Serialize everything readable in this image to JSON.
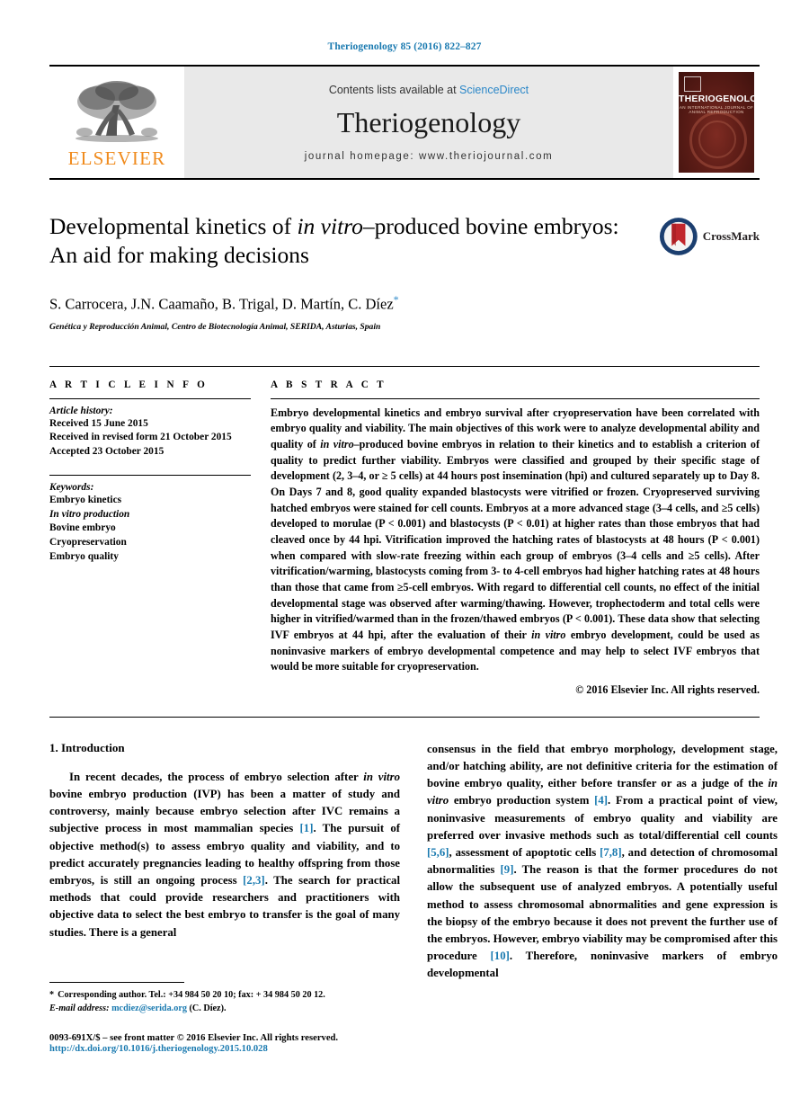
{
  "running_head": "Theriogenology 85 (2016) 822–827",
  "masthead": {
    "publisher_logo_label": "ELSEVIER",
    "contents_prefix": "Contents lists available at ",
    "contents_link": "ScienceDirect",
    "journal_title": "Theriogenology",
    "homepage": "journal homepage: www.theriojournal.com",
    "cover_title": "THERIOGENOLOGY",
    "cover_subtitle": "AN INTERNATIONAL JOURNAL OF ANIMAL REPRODUCTION"
  },
  "article": {
    "title_part1": "Developmental kinetics of ",
    "title_italic": "in vitro",
    "title_part2": "–produced bovine embryos: An aid for making decisions",
    "authors": "S. Carrocera, J.N. Caamaño, B. Trigal, D. Martín, C. Díez",
    "corresponding_marker": "*",
    "affiliation": "Genética y Reproducción Animal, Centro de Biotecnología Animal, SERIDA, Asturias, Spain",
    "crossmark_label": "CrossMark"
  },
  "article_info": {
    "heading": "A R T I C L E   I N F O",
    "history_label": "Article history:",
    "history": [
      "Received 15 June 2015",
      "Received in revised form 21 October 2015",
      "Accepted 23 October 2015"
    ],
    "keywords_label": "Keywords:",
    "keywords": [
      "Embryo kinetics",
      "In vitro production",
      "Bovine embryo",
      "Cryopreservation",
      "Embryo quality"
    ]
  },
  "abstract": {
    "heading": "A B S T R A C T",
    "text_a": "Embryo developmental kinetics and embryo survival after cryopreservation have been correlated with embryo quality and viability. The main objectives of this work were to analyze developmental ability and quality of ",
    "text_italic_1": "in vitro",
    "text_b": "–produced bovine embryos in relation to their kinetics and to establish a criterion of quality to predict further viability. Embryos were classified and grouped by their specific stage of development (2, 3–4, or ≥ 5 cells) at 44 hours post insemination (hpi) and cultured separately up to Day 8. On Days 7 and 8, good quality expanded blastocysts were vitrified or frozen. Cryopreserved surviving hatched embryos were stained for cell counts. Embryos at a more advanced stage (3–4 cells, and ≥5 cells) developed to morulae (P < 0.001) and blastocysts (P < 0.01) at higher rates than those embryos that had cleaved once by 44 hpi. Vitrification improved the hatching rates of blastocysts at 48 hours (P < 0.001) when compared with slow-rate freezing within each group of embryos (3–4 cells and ≥5 cells). After vitrification/warming, blastocysts coming from 3- to 4-cell embryos had higher hatching rates at 48 hours than those that came from ≥5-cell embryos. With regard to differential cell counts, no effect of the initial developmental stage was observed after warming/thawing. However, trophectoderm and total cells were higher in vitrified/warmed than in the frozen/thawed embryos (P < 0.001). These data show that selecting IVF embryos at 44 hpi, after the evaluation of their ",
    "text_italic_2": "in vitro",
    "text_c": " embryo development, could be used as noninvasive markers of embryo developmental competence and may help to select IVF embryos that would be more suitable for cryopreservation.",
    "copyright": "© 2016 Elsevier Inc. All rights reserved."
  },
  "introduction": {
    "heading": "1. Introduction",
    "left_a": "In recent decades, the process of embryo selection after ",
    "left_italic_1": "in vitro",
    "left_b": " bovine embryo production (IVP) has been a matter of study and controversy, mainly because embryo selection after IVC remains a subjective process in most mammalian species ",
    "ref_1": "[1]",
    "left_c": ". The pursuit of objective method(s) to assess embryo quality and viability, and to predict accurately pregnancies leading to healthy offspring from those embryos, is still an ongoing process ",
    "ref_2": "[2,3]",
    "left_d": ". The search for practical methods that could provide researchers and practitioners with objective data to select the best embryo to transfer is the goal of many studies. There is a general",
    "right_a": "consensus in the field that embryo morphology, development stage, and/or hatching ability, are not definitive criteria for the estimation of bovine embryo quality, either before transfer or as a judge of the ",
    "right_italic_1": "in vitro",
    "right_b": " embryo production system ",
    "ref_4": "[4]",
    "right_c": ". From a practical point of view, noninvasive measurements of embryo quality and viability are preferred over invasive methods such as total/differential cell counts ",
    "ref_56": "[5,6]",
    "right_d": ", assessment of apoptotic cells ",
    "ref_78": "[7,8]",
    "right_e": ", and detection of chromosomal abnormalities ",
    "ref_9": "[9]",
    "right_f": ". The reason is that the former procedures do not allow the subsequent use of analyzed embryos. A potentially useful method to assess chromosomal abnormalities and gene expression is the biopsy of the embryo because it does not prevent the further use of the embryos. However, embryo viability may be compromised after this procedure ",
    "ref_10": "[10]",
    "right_g": ". Therefore, noninvasive markers of embryo developmental"
  },
  "footnotes": {
    "corresponding_star": "*",
    "corresponding_text": "Corresponding author. Tel.: +34 984 50 20 10; fax: + 34 984 50 20 12.",
    "email_label": "E-mail address:",
    "email": "mcdiez@serida.org",
    "email_owner": "(C. Díez).",
    "issn_line": "0093-691X/$ – see front matter © 2016 Elsevier Inc. All rights reserved.",
    "doi": "http://dx.doi.org/10.1016/j.theriogenology.2015.10.028"
  },
  "colors": {
    "link_blue": "#1a7ab0",
    "elsevier_orange": "#f08b1d",
    "masthead_gray": "#e9e9e9",
    "cover_maroon": "#5e1d17"
  }
}
